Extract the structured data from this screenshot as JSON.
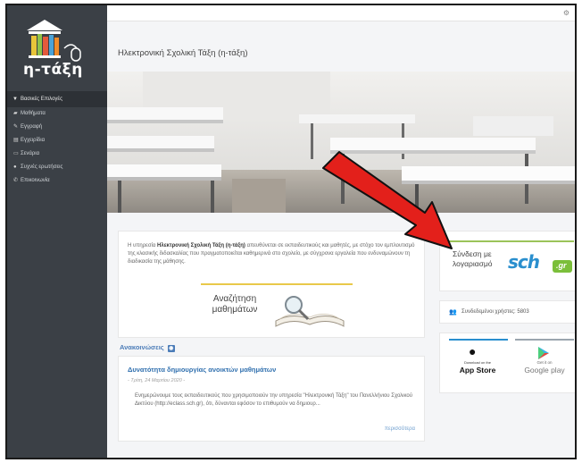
{
  "app": {
    "logo_text": "η-τάξη",
    "page_title": "Ηλεκτρονική Σχολική Τάξη (η-τάξη)"
  },
  "sidebar": {
    "header_label": "Βασικές Επιλογές",
    "items": [
      {
        "label": "Μαθήματα",
        "icon": "graduation-cap-icon"
      },
      {
        "label": "Εγγραφή",
        "icon": "edit-icon"
      },
      {
        "label": "Εγχειρίδια",
        "icon": "manual-icon"
      },
      {
        "label": "Σενάρια",
        "icon": "card-icon"
      },
      {
        "label": "Συχνές ερωτήσεις",
        "icon": "question-icon"
      },
      {
        "label": "Επικοινωνία",
        "icon": "phone-icon"
      }
    ]
  },
  "intro": {
    "text_prefix": "Η υπηρεσία ",
    "text_bold": "Ηλεκτρονική Σχολική Τάξη (η-τάξη)",
    "text_suffix": " απευθύνεται σε εκπαιδευτικούς και μαθητές, με στόχο τον εμπλουτισμό της κλασικής διδασκαλίας που πραγματοποιείται καθημερινά στο σχολείο, με σύγχρονα εργαλεία που ενδυναμώνουν τη διαδικασία της μάθησης.",
    "search_label": "Αναζήτηση μαθημάτων"
  },
  "announcements": {
    "heading": "Ανακοινώσεις",
    "item": {
      "title": "Δυνατότητα δημιουργίας ανοικτών μαθημάτων",
      "date": "- Τρίτη, 24 Μαρτίου 2020 -",
      "body": "Ενημερώνουμε τους εκπαιδευτικούς που χρησιμοποιούν την υπηρεσία \"Ηλεκτρονική Τάξη\" του Πανελλήνιου Σχολικού Δικτύου (http://eclass.sch.gr), ότι, δύνανται εφόσον το επιθυμούν να δημιουρ...",
      "more": "περισσότερα"
    }
  },
  "login": {
    "label": "Σύνδεση με λογαριασμό",
    "brand": "sch",
    "brand_suffix": ".gr"
  },
  "users": {
    "label": "Συνδεδεμένοι χρήστες: 5803"
  },
  "apps": {
    "apple_small": "Download on the",
    "apple_big": "App Store",
    "google_small": "Get it on",
    "google_big": "Google play"
  },
  "colors": {
    "sidebar": "#3b4046",
    "accent_blue": "#2a8fce",
    "arrow_red": "#e3201b"
  }
}
